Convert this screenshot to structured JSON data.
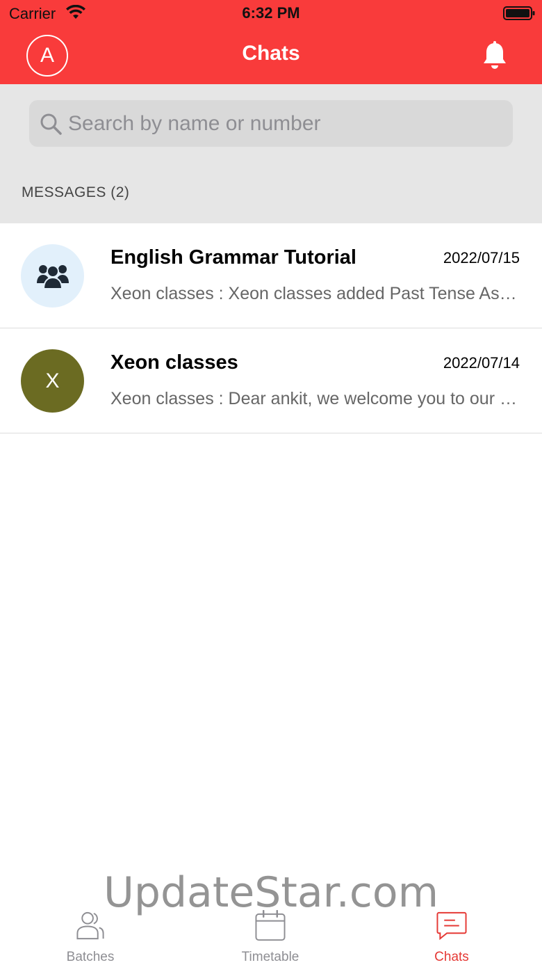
{
  "status_bar": {
    "carrier": "Carrier",
    "time": "6:32 PM"
  },
  "header": {
    "avatar_letter": "A",
    "title": "Chats"
  },
  "search": {
    "placeholder": "Search by name or number"
  },
  "section": {
    "title": "MESSAGES (2)"
  },
  "chats": [
    {
      "name": "English Grammar Tutorial",
      "date": "2022/07/15",
      "preview": "Xeon classes : Xeon classes added Past Tense Assignment",
      "avatar": "group-icon",
      "avatar_color": "#e2f0fb"
    },
    {
      "name": "Xeon classes",
      "date": "2022/07/14",
      "preview": "Xeon classes : Dear ankit, we welcome you to our class",
      "avatar_letter": "X",
      "avatar_color": "#6b6b22"
    }
  ],
  "watermark": "UpdateStar.com",
  "tabs": [
    {
      "label": "Batches",
      "icon": "users-icon",
      "active": false
    },
    {
      "label": "Timetable",
      "icon": "calendar-icon",
      "active": false
    },
    {
      "label": "Chats",
      "icon": "chat-icon",
      "active": true
    }
  ],
  "colors": {
    "accent": "#f93b3b",
    "active_tab": "#e53935"
  }
}
